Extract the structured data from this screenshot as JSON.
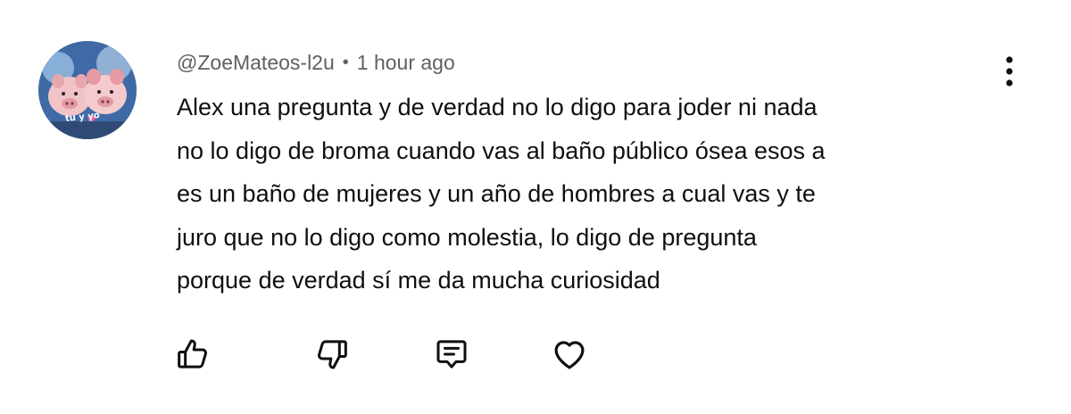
{
  "comment": {
    "author": "@ZoeMateos-l2u",
    "separator": "•",
    "timestamp": "1 hour ago",
    "avatar_text": "tu y yo",
    "lines": [
      "Alex una pregunta y de verdad no lo digo para joder ni nada",
      "no lo digo de broma cuando vas al baño público ósea esos a",
      "es un baño de mujeres y un año de hombres a cual vas y te",
      "juro que no lo digo como molestia, lo digo de pregunta",
      "porque de verdad sí me da mucha curiosidad"
    ]
  },
  "actions": {
    "like_icon": "thumbs-up-icon",
    "dislike_icon": "thumbs-down-icon",
    "reply_icon": "comment-icon",
    "heart_icon": "heart-icon",
    "menu_icon": "more-vertical-icon"
  },
  "colors": {
    "text": "#0f0f0f",
    "meta": "#606060",
    "icon": "#0f0f0f",
    "background": "#ffffff"
  }
}
